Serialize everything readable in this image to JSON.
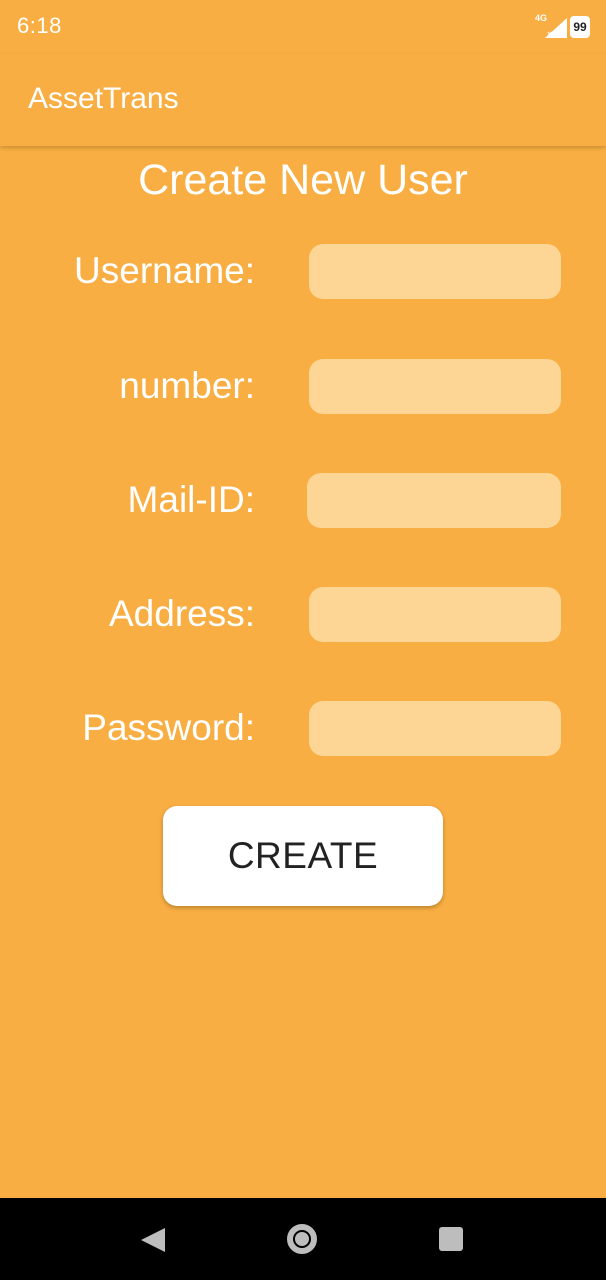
{
  "status_bar": {
    "time": "6:18",
    "network": "4G",
    "battery": "99",
    "icons": [
      "signal-icon",
      "battery-icon"
    ]
  },
  "app_bar": {
    "title": "AssetTrans"
  },
  "page": {
    "title": "Create New User"
  },
  "form": {
    "fields": [
      {
        "label": "Username:",
        "value": "",
        "placeholder": ""
      },
      {
        "label": "number:",
        "value": "",
        "placeholder": ""
      },
      {
        "label": "Mail-ID:",
        "value": "",
        "placeholder": ""
      },
      {
        "label": "Address:",
        "value": "",
        "placeholder": ""
      },
      {
        "label": "Password:",
        "value": "",
        "placeholder": ""
      }
    ],
    "submit_label": "CREATE"
  },
  "nav_bar": {
    "icons": [
      "back-icon",
      "home-icon",
      "recents-icon"
    ]
  },
  "colors": {
    "background": "#F8AE42",
    "input_fill": "#FDD594",
    "button_fill": "#FFFFFF",
    "nav_bar": "#000000"
  }
}
